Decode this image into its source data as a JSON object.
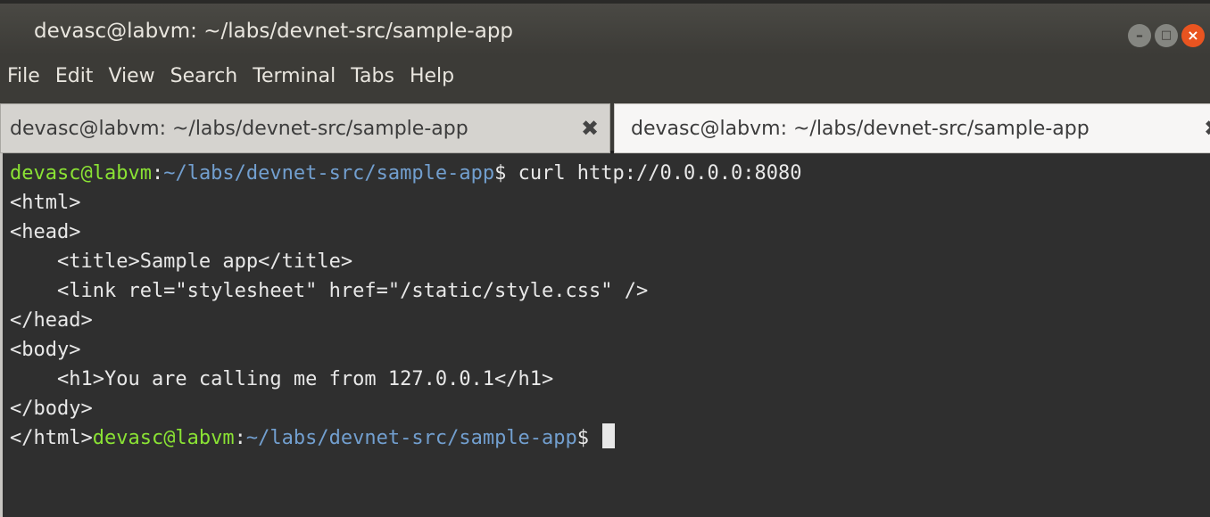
{
  "window": {
    "title": "devasc@labvm: ~/labs/devnet-src/sample-app",
    "buttons": {
      "minimize": "–",
      "maximize": "□",
      "close": "×"
    }
  },
  "menu": [
    "File",
    "Edit",
    "View",
    "Search",
    "Terminal",
    "Tabs",
    "Help"
  ],
  "tabs": [
    {
      "label": "devasc@labvm: ~/labs/devnet-src/sample-app",
      "close_icon": "✖",
      "active": false
    },
    {
      "label": "devasc@labvm: ~/labs/devnet-src/sample-app",
      "close_icon": "✖",
      "active": true
    }
  ],
  "terminal": {
    "prompt_user": "devasc@labvm",
    "prompt_sep": ":",
    "prompt_path": "~/labs/devnet-src/sample-app",
    "prompt_symbol": "$ ",
    "command": "curl http://0.0.0.0:8080",
    "output": [
      "<html>",
      "<head>",
      "    <title>Sample app</title>",
      "    <link rel=\"stylesheet\" href=\"/static/style.css\" />",
      "</head>",
      "<body>",
      "    <h1>You are calling me from 127.0.0.1</h1>",
      "</body>"
    ],
    "last_line_prefix": "</html>",
    "colors": {
      "user": "#8ae234",
      "path": "#729fcf",
      "text": "#e8e8e8",
      "background": "#2f2f2f"
    }
  }
}
